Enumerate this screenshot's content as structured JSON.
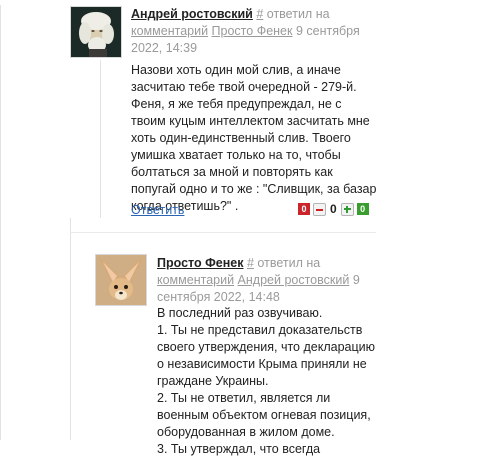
{
  "comments": [
    {
      "author": "Андрей ростовский",
      "hash": "#",
      "replied_label": "ответил на",
      "comment_link": "комментарий",
      "replied_to": "Просто Фенек",
      "date_line_1": "9 сентября",
      "date_line_2": "2022, 14:39",
      "body": [
        "Назови хоть один мой слив, а иначе",
        "засчитаю тебе твой очередной - 279-й.",
        "Феня, я же тебя предупреждал, не с",
        "твоим куцым интеллектом засчитать мне",
        "хоть один-единственный слив. Твоего",
        "умишка хватает только на то, чтобы",
        "болтаться за мной и повторять как",
        "попугай одно и то же : \"Сливщик, за базар",
        "когда ответишь?\" ."
      ],
      "reply_label": "Ответить",
      "votes": {
        "down_count": "0",
        "score": "0",
        "up_count": "0"
      }
    },
    {
      "author": "Просто Фенек",
      "hash": "#",
      "replied_label": "ответил на",
      "comment_link": "комментарий",
      "replied_to": "Андрей ростовский",
      "date_line_1": "9",
      "date_line_2": "сентября 2022, 14:48",
      "body": [
        "В последний раз озвучиваю.",
        "1. Ты не представил доказательств",
        "своего утверждения, что декларацию",
        "о независимости Крыма приняли не",
        "граждане Украины.",
        "2. Ты не ответил, является ли",
        "военным объектом огневая позиция,",
        "оборудованная в жилом доме.",
        "3. Ты утверждал, что всегда"
      ]
    }
  ],
  "colors": {
    "author": "#222222",
    "meta": "#9a9a9a",
    "reply_link": "#2a64b2",
    "vote_down": "#c9252b",
    "vote_up": "#3a9d2f"
  }
}
